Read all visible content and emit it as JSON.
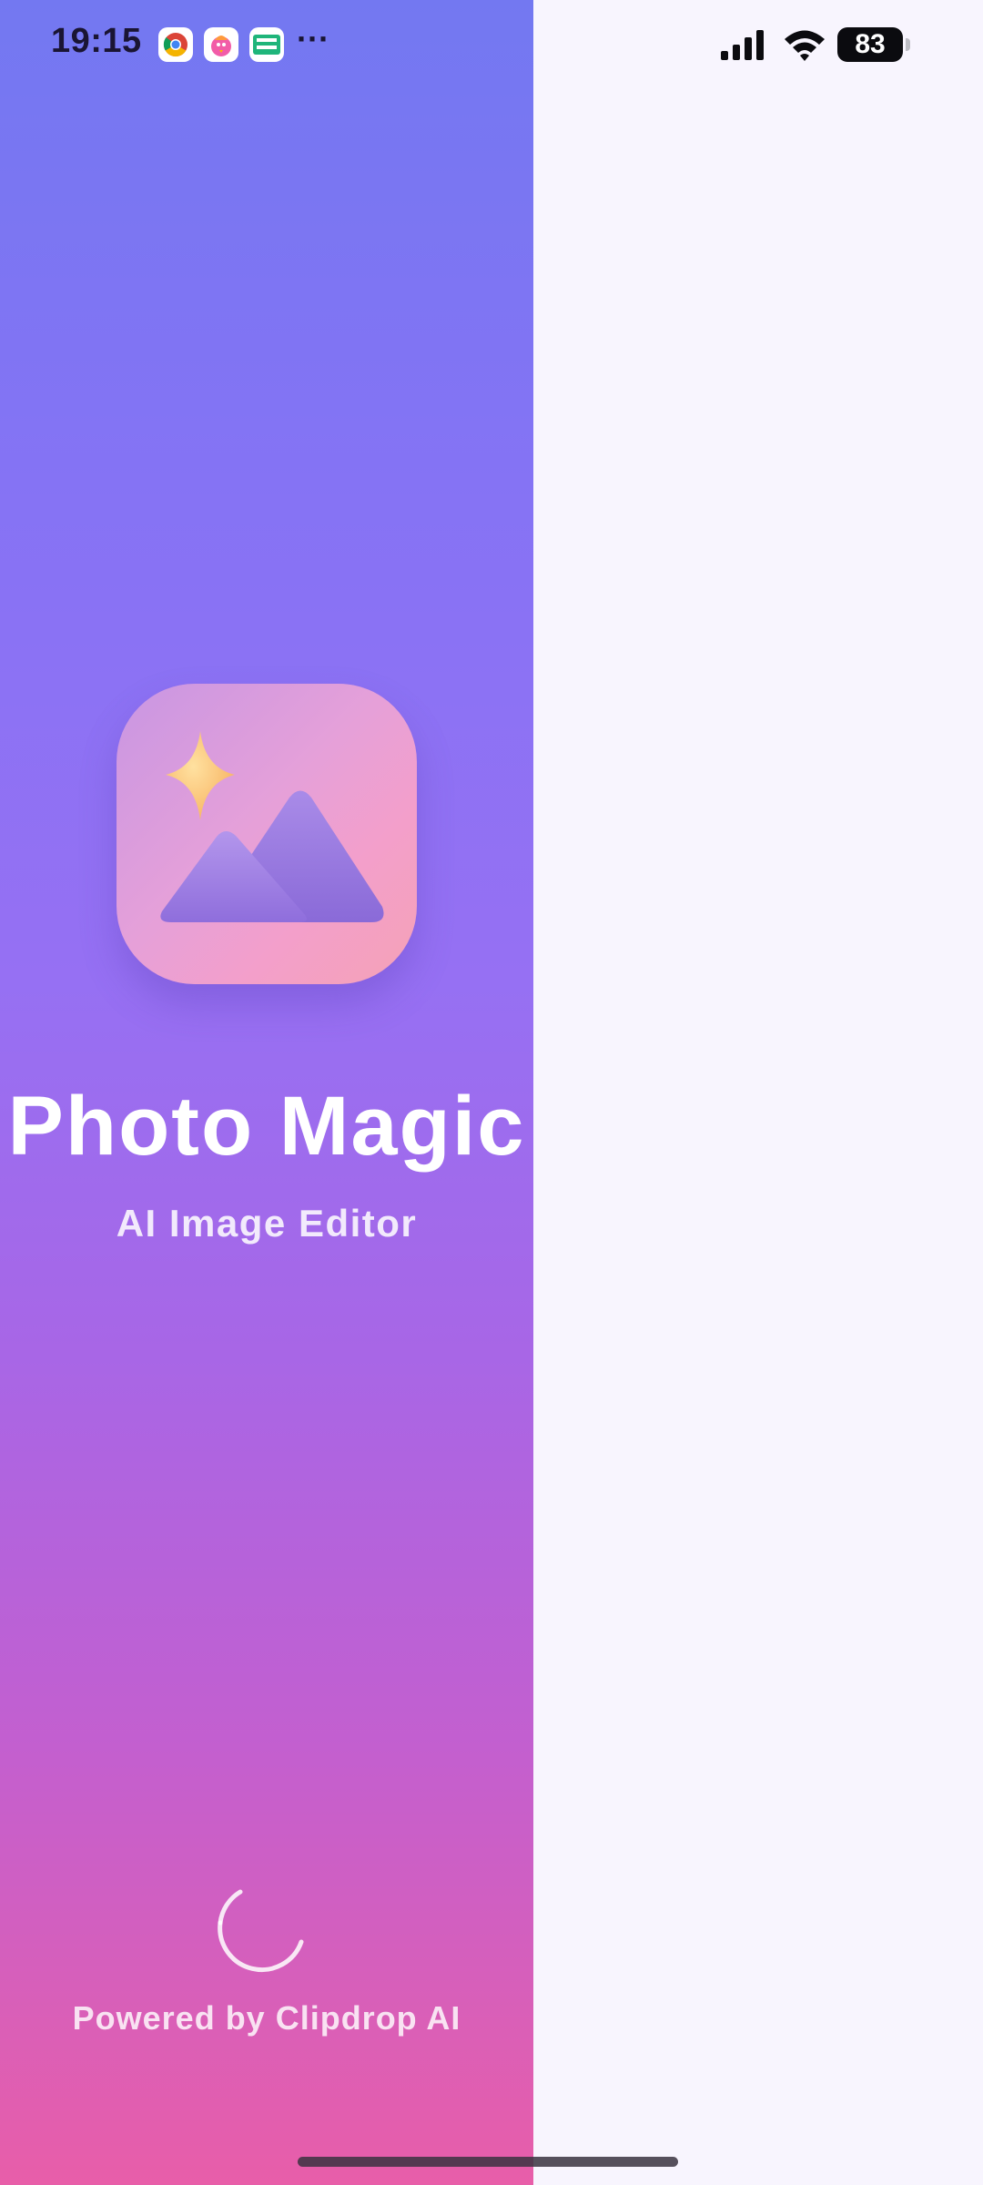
{
  "status_bar": {
    "time": "19:15",
    "notification_icons": [
      "chrome-icon",
      "bird-app-icon",
      "temp-mail-icon"
    ],
    "more_indicator": "···",
    "battery_level": "83",
    "signal": "full",
    "wifi": "connected"
  },
  "splash": {
    "app_icon": "photo-sparkle-icon",
    "title": "Photo Magic",
    "subtitle": "AI Image Editor",
    "loading": true,
    "footer": "Powered by Clipdrop AI"
  },
  "colors": {
    "gradient_top": "#7378f1",
    "gradient_middle": "#9670f3",
    "gradient_bottom": "#e85ea9",
    "background": "#f8f5fe",
    "sparkle": "#fbc274",
    "mountains": "#9a7be0"
  }
}
